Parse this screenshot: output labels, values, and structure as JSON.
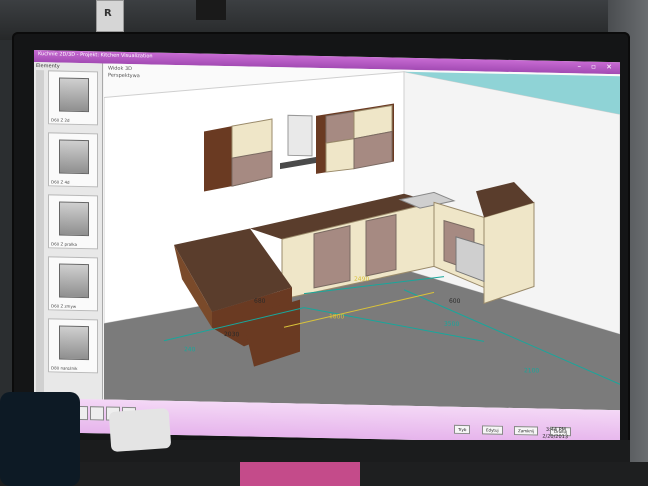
{
  "screen_window": {
    "title": "Kuchnie 2D/3D - Projekt: Kitchen Visualization",
    "controls": "– ▫ ✕"
  },
  "sidebar": {
    "header": "Elementy",
    "thumbs": [
      {
        "label": "D60 Z 2d"
      },
      {
        "label": "D60 Z 4d"
      },
      {
        "label": "D60 Z pralka"
      },
      {
        "label": "D60 Z zmyw"
      },
      {
        "label": "D80 narożnik"
      }
    ]
  },
  "viewport": {
    "label_view": "Widok 3D",
    "label_mode": "Perspektywa"
  },
  "dimensions": [
    "680",
    "2490",
    "600",
    "240",
    "2100",
    "3500",
    "1800",
    "2030"
  ],
  "taskbar": {
    "clock_time": "3:44 PM",
    "clock_date": "2/20/2013",
    "buttons": [
      "Tryb",
      "Edytuj",
      "Zamknij",
      "Drukuj"
    ]
  },
  "background": {
    "top_object_text": "R"
  },
  "colors": {
    "window_title": "#b558c4",
    "taskbar": "#e9bdee",
    "floor": "#7a7a7a",
    "wood": "#6a3a22",
    "cabinet_cream": "#efe6c8",
    "cabinet_mauve": "#a68a82",
    "worktop": "#5a3d2c",
    "dimension_line": "#18a79c",
    "dimension_yellow": "#d9c23a"
  }
}
